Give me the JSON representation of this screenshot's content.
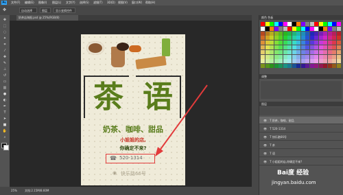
{
  "app": {
    "logo": "Ps"
  },
  "menu": [
    "文件(F)",
    "编辑(E)",
    "图像(I)",
    "图层(L)",
    "文字(Y)",
    "选择(S)",
    "滤镜(T)",
    "3D(D)",
    "视图(V)",
    "窗口(W)",
    "帮助(H)"
  ],
  "options": {
    "auto_select": "自动选择",
    "layer": "图层",
    "show_transform": "显示变换控件"
  },
  "document_tab": "奶茶店海报.psd @ 25%(RGB/8)",
  "status": {
    "zoom": "25%",
    "doc_info": "文档:2.15M/8.60M"
  },
  "poster": {
    "char1": "茶",
    "char2": "语",
    "subtitle": "奶茶、咖啡、甜品",
    "line1": "小姐姐的店,",
    "line2": "你确定不来?",
    "phone": "520-1314",
    "address": "快乐路66号"
  },
  "panels": {
    "color_header": "颜色  色板",
    "adjust_header": "调整",
    "layers_header": "图层",
    "layers": [
      "奶茶、咖啡、甜品",
      "520-1314",
      "快乐路66号",
      "茶",
      "语",
      "小姐姐的店,你确定不来?"
    ]
  },
  "watermark": {
    "brand": "Bai度 经验",
    "url": "jingyan.baidu.com"
  },
  "colors": {
    "accent_green": "#5a7d1c",
    "callout_red": "#e23b3b",
    "swatch_palette": [
      "#ff0000",
      "#ffff00",
      "#00ff00",
      "#00ffff",
      "#0000ff",
      "#ff00ff",
      "#ffffff",
      "#000000",
      "#ff8000",
      "#8000ff",
      "#808080",
      "#c0c0c0"
    ]
  }
}
